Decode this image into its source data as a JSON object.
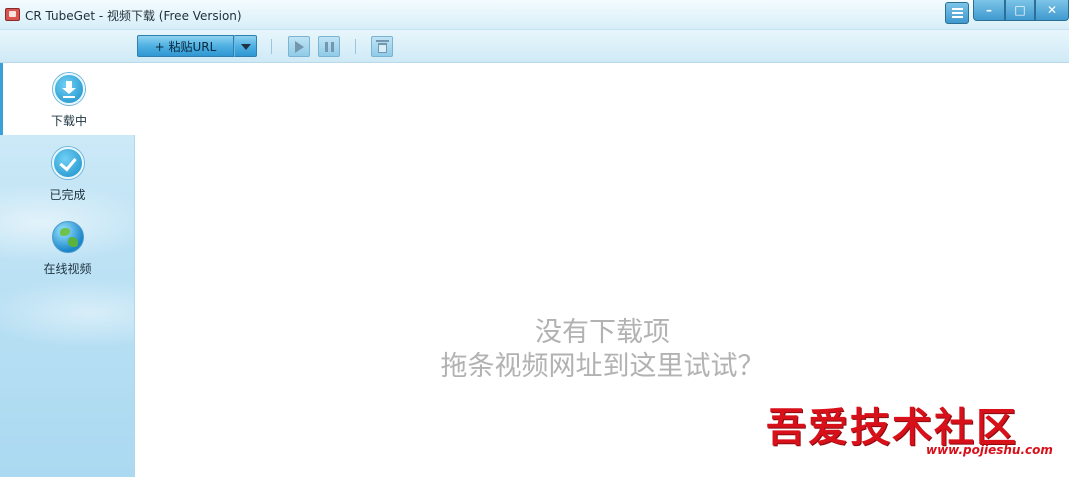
{
  "window": {
    "title": "CR TubeGet - 视频下载 (Free Version)",
    "controls": {
      "minimize": "–",
      "maximize": "□",
      "close": "✕"
    }
  },
  "toolbar": {
    "paste_url_label": "+ 粘贴URL",
    "icons": [
      "play-icon",
      "pause-icon",
      "trash-icon"
    ]
  },
  "sidebar": {
    "items": [
      {
        "label": "下载中",
        "icon": "download-icon",
        "active": true
      },
      {
        "label": "已完成",
        "icon": "check-icon",
        "active": false
      },
      {
        "label": "在线视频",
        "icon": "globe-icon",
        "active": false
      }
    ]
  },
  "main": {
    "empty_title": "没有下载项",
    "empty_hint": "拖条视频网址到这里试试？"
  },
  "watermark": {
    "text": "吾爱技术社区",
    "url": "www.pojieshu.com"
  },
  "colors": {
    "accent": "#3aa0d8",
    "empty_text": "#b2b2b2",
    "watermark": "#d8101a"
  }
}
